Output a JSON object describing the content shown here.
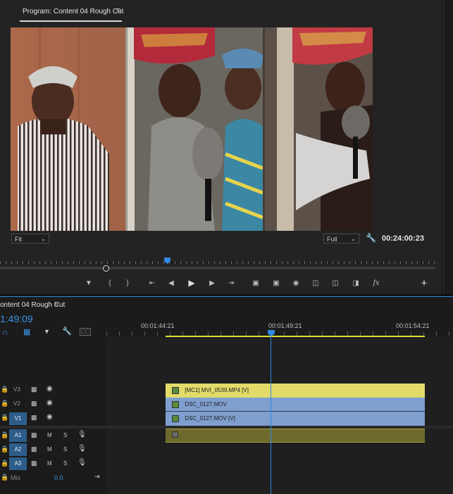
{
  "program": {
    "tab_label": "Program: Content 04 Rough Cut",
    "fit_label": "Fit",
    "quality_label": "Full",
    "timecode": "00:24:00:23"
  },
  "timeline": {
    "tab_label": "ontent 04 Rough Cut",
    "playhead_time": "1:49:09",
    "ruler": [
      "00:01:44:21",
      "00:01:49:21",
      "00:01:54:21"
    ],
    "tracks_video": [
      {
        "name": "V3",
        "target": "",
        "clip": "[MC1] MVI_0539.MP4 [V]",
        "color": "#e2db6a"
      },
      {
        "name": "V2",
        "target": "",
        "clip": "DSC_0127.MOV",
        "color": "#7f9fcf"
      },
      {
        "name": "V1",
        "target": "V1",
        "clip": "DSC_0127.MOV [V]",
        "color": "#7f9fcf"
      }
    ],
    "tracks_audio": [
      {
        "name": "A1",
        "target": "A1",
        "m": "M",
        "s": "S"
      },
      {
        "name": "A2",
        "target": "",
        "m": "M",
        "s": "S"
      },
      {
        "name": "A3",
        "target": "",
        "m": "M",
        "s": "S"
      }
    ],
    "mix_label": "Mix",
    "mix_value": "0.0"
  },
  "colors": {
    "accent": "#2e8ae6",
    "selection": "#2d5d8a"
  }
}
